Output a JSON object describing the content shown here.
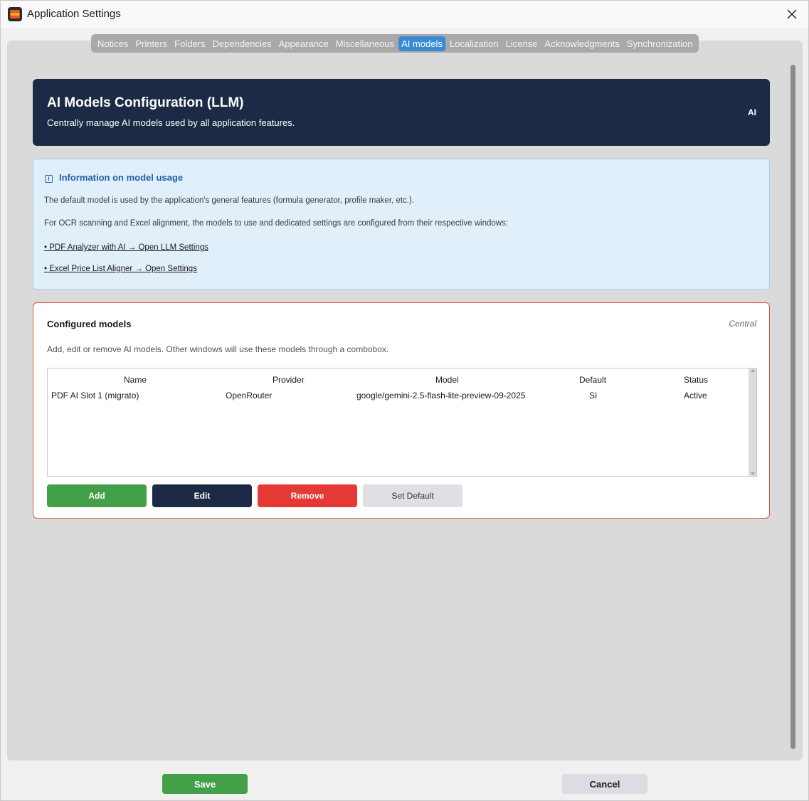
{
  "window": {
    "title": "Application Settings",
    "close_icon": "close-icon"
  },
  "tabs": [
    {
      "label": "Notices",
      "active": false
    },
    {
      "label": "Printers",
      "active": false
    },
    {
      "label": "Folders",
      "active": false
    },
    {
      "label": "Dependencies",
      "active": false
    },
    {
      "label": "Appearance",
      "active": false
    },
    {
      "label": "Miscellaneous",
      "active": false
    },
    {
      "label": "AI models",
      "active": true
    },
    {
      "label": "Localization",
      "active": false
    },
    {
      "label": "License",
      "active": false
    },
    {
      "label": "Acknowledgments",
      "active": false
    },
    {
      "label": "Synchronization",
      "active": false
    }
  ],
  "hero": {
    "title": "AI Models Configuration (LLM)",
    "subtitle": "Centrally manage AI models used by all application features.",
    "badge": "AI"
  },
  "info": {
    "title": "Information on model usage",
    "icon": "info-icon",
    "p1": "The default model is used by the application's general features (formula generator, profile maker, etc.).",
    "p2": "For OCR scanning and Excel alignment, the models to use and dedicated settings are configured from their respective windows:",
    "link1": "• PDF Analyzer with AI → Open LLM Settings",
    "link2": "• Excel Price List Aligner → Open Settings"
  },
  "models": {
    "title": "Configured models",
    "tag": "Central",
    "description": "Add, edit or remove AI models. Other windows will use these models through a combobox.",
    "columns": [
      "Name",
      "Provider",
      "Model",
      "Default",
      "Status"
    ],
    "rows": [
      [
        "PDF AI Slot 1 (migrato)",
        "OpenRouter",
        "google/gemini-2.5-flash-lite-preview-09-2025",
        "Sì",
        "Active"
      ]
    ],
    "buttons": {
      "add": "Add",
      "edit": "Edit",
      "remove": "Remove",
      "set_default": "Set Default"
    }
  },
  "footer": {
    "save": "Save",
    "cancel": "Cancel"
  },
  "colors": {
    "accent": "#3a8ad6",
    "hero_bg": "#1c2a45",
    "add_green": "#43a048",
    "remove_red": "#e53935",
    "border_red": "#e0553e",
    "info_bg": "#e1effb"
  }
}
